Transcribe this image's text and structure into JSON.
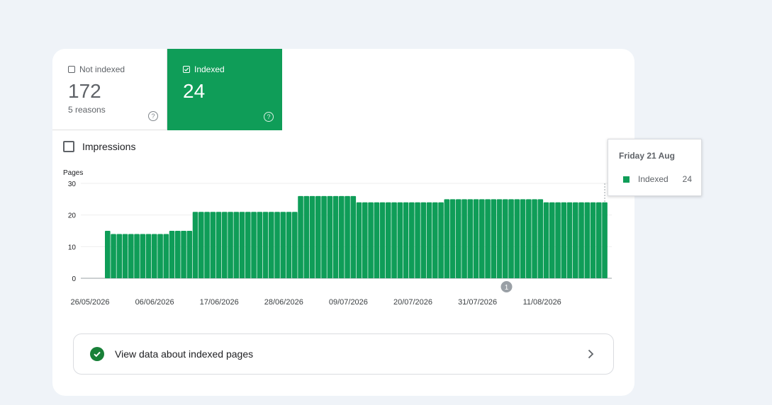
{
  "colors": {
    "accent": "#0f9d58",
    "bar": "#0f9d58",
    "check": "#188038",
    "background": "#eff3f8"
  },
  "tiles": {
    "not_indexed": {
      "label": "Not indexed",
      "value": "172",
      "sub": "5 reasons",
      "help": "?"
    },
    "indexed": {
      "label": "Indexed",
      "value": "24",
      "help": "?"
    }
  },
  "metric": {
    "label": "Impressions"
  },
  "chart_data": {
    "type": "bar",
    "ylabel": "Pages",
    "ylim": [
      0,
      30
    ],
    "yticks": [
      "30",
      "20",
      "10",
      "0"
    ],
    "x_tick_labels": [
      "26/05/2026",
      "06/06/2026",
      "17/06/2026",
      "28/06/2026",
      "09/07/2026",
      "20/07/2026",
      "31/07/2026",
      "11/08/2026"
    ],
    "annotation": {
      "label": "1",
      "date": "04/08/2026"
    },
    "grid": true,
    "series": [
      {
        "values": [
          15,
          14,
          14,
          14,
          14,
          14,
          14,
          14,
          14,
          14,
          14,
          15,
          15,
          15,
          15,
          21,
          21,
          21,
          21,
          21,
          21,
          21,
          21,
          21,
          21,
          21,
          21,
          21,
          21,
          21,
          21,
          21,
          21,
          26,
          26,
          26,
          26,
          26,
          26,
          26,
          26,
          26,
          26,
          24,
          24,
          24,
          24,
          24,
          24,
          24,
          24,
          24,
          24,
          24,
          24,
          24,
          24,
          24,
          25,
          25,
          25,
          25,
          25,
          25,
          25,
          25,
          25,
          25,
          25,
          25,
          25,
          25,
          25,
          25,
          25,
          24,
          24,
          24,
          24,
          24,
          24,
          24,
          24,
          24,
          24,
          24
        ]
      }
    ]
  },
  "tooltip": {
    "title": "Friday 21 Aug",
    "series_label": "Indexed",
    "value": "24"
  },
  "view_data": {
    "label": "View data about indexed pages"
  }
}
